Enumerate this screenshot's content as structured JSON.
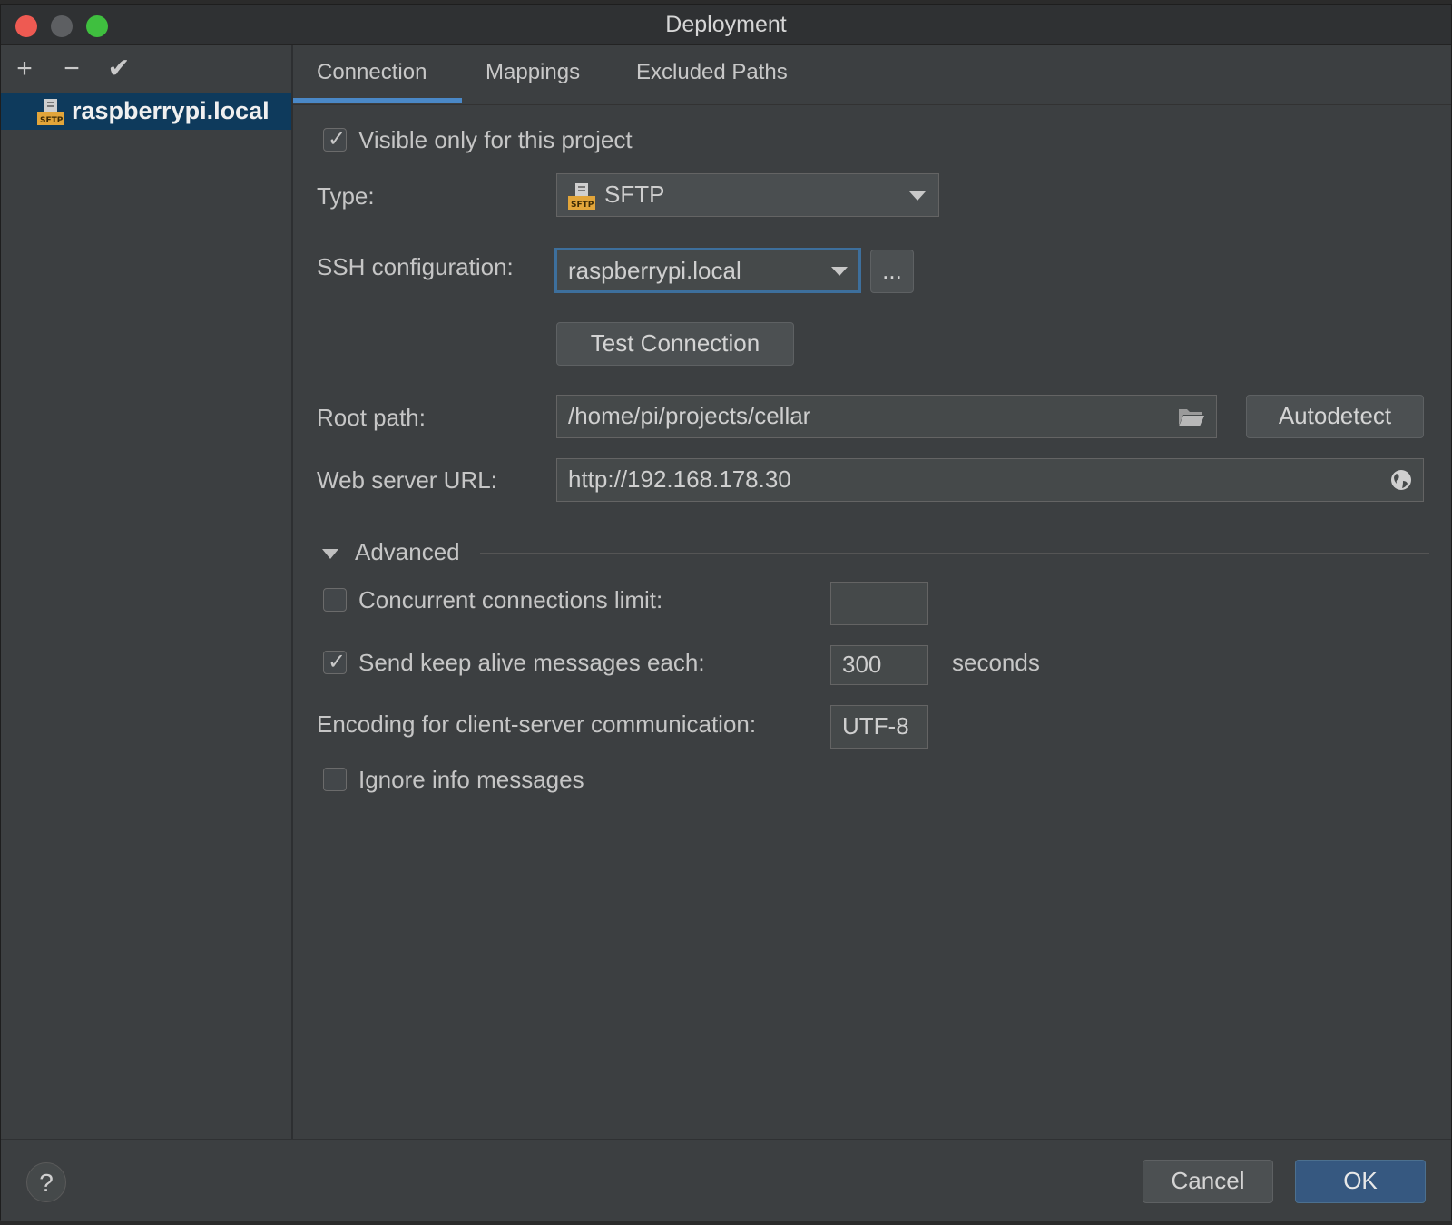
{
  "window": {
    "title": "Deployment"
  },
  "sidebar": {
    "toolbar": {
      "add": "+",
      "remove": "−",
      "apply": "✔"
    },
    "items": [
      {
        "label": "raspberrypi.local",
        "icon": "sftp-server-icon"
      }
    ]
  },
  "tabs": [
    {
      "label": "Connection",
      "selected": true
    },
    {
      "label": "Mappings",
      "selected": false
    },
    {
      "label": "Excluded Paths",
      "selected": false
    }
  ],
  "connection": {
    "visible_only": {
      "label": "Visible only for this project",
      "checked": true
    },
    "type": {
      "label": "Type:",
      "value": "SFTP"
    },
    "ssh": {
      "label": "SSH configuration:",
      "value": "raspberrypi.local",
      "browse": "..."
    },
    "test_button": "Test Connection",
    "root_path": {
      "label": "Root path:",
      "value": "/home/pi/projects/cellar",
      "autodetect": "Autodetect"
    },
    "web_url": {
      "label": "Web server URL:",
      "value": "http://192.168.178.30"
    }
  },
  "advanced": {
    "title": "Advanced",
    "concurrent": {
      "label": "Concurrent connections limit:",
      "checked": false,
      "value": ""
    },
    "keep_alive": {
      "label": "Send keep alive messages each:",
      "checked": true,
      "value": "300",
      "unit": "seconds"
    },
    "encoding": {
      "label": "Encoding for client-server communication:",
      "value": "UTF-8"
    },
    "ignore_info": {
      "label": "Ignore info messages",
      "checked": false
    }
  },
  "footer": {
    "help": "?",
    "cancel": "Cancel",
    "ok": "OK"
  },
  "colors": {
    "accent": "#4a88c7",
    "primary_button": "#365880",
    "selection": "#0e3a5c"
  }
}
